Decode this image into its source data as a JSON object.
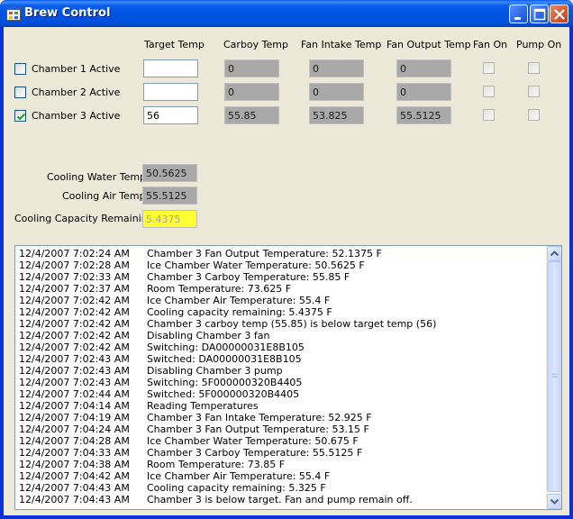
{
  "window": {
    "title": "Brew Control",
    "icons": {
      "app": "app-form-icon",
      "minimize": "minimize-icon",
      "maximize": "maximize-icon",
      "close": "close-icon"
    }
  },
  "headers": {
    "target_temp": "Target Temp",
    "carboy_temp": "Carboy Temp",
    "fan_intake_temp": "Fan Intake Temp",
    "fan_output_temp": "Fan Output Temp",
    "fan_on": "Fan On",
    "pump_on": "Pump On"
  },
  "chambers": [
    {
      "label": "Chamber 1 Active",
      "active": false,
      "target_temp": "",
      "carboy_temp": "0",
      "fan_intake_temp": "0",
      "fan_output_temp": "0",
      "fan_on": false,
      "pump_on": false
    },
    {
      "label": "Chamber 2 Active",
      "active": false,
      "target_temp": "",
      "carboy_temp": "0",
      "fan_intake_temp": "0",
      "fan_output_temp": "0",
      "fan_on": false,
      "pump_on": false
    },
    {
      "label": "Chamber 3 Active",
      "active": true,
      "target_temp": "56",
      "carboy_temp": "55.85",
      "fan_intake_temp": "53.825",
      "fan_output_temp": "55.5125",
      "fan_on": false,
      "pump_on": false
    }
  ],
  "cooling": {
    "water_temp_label": "Cooling Water Temp",
    "water_temp": "50.5625",
    "air_temp_label": "Cooling Air Temp",
    "air_temp": "55.5125",
    "capacity_label": "Cooling Capacity Remaining",
    "capacity": "5.4375"
  },
  "log": [
    {
      "time": "12/4/2007 7:02:24 AM",
      "message": "Chamber 3 Fan Output Temperature: 52.1375 F"
    },
    {
      "time": "12/4/2007 7:02:28 AM",
      "message": "Ice Chamber Water Temperature: 50.5625 F"
    },
    {
      "time": "12/4/2007 7:02:33 AM",
      "message": "Chamber 3 Carboy Temperature: 55.85 F"
    },
    {
      "time": "12/4/2007 7:02:37 AM",
      "message": "Room Temperature: 73.625 F"
    },
    {
      "time": "12/4/2007 7:02:42 AM",
      "message": "Ice Chamber Air Temperature: 55.4 F"
    },
    {
      "time": "12/4/2007 7:02:42 AM",
      "message": "Cooling capacity remaining:  5.4375 F"
    },
    {
      "time": "12/4/2007 7:02:42 AM",
      "message": "Chamber 3 carboy temp (55.85) is below target temp (56)"
    },
    {
      "time": "12/4/2007 7:02:42 AM",
      "message": "Disabling Chamber 3 fan"
    },
    {
      "time": "12/4/2007 7:02:42 AM",
      "message": "Switching: DA00000031E8B105"
    },
    {
      "time": "12/4/2007 7:02:43 AM",
      "message": "Switched: DA00000031E8B105"
    },
    {
      "time": "12/4/2007 7:02:43 AM",
      "message": "Disabling Chamber 3 pump"
    },
    {
      "time": "12/4/2007 7:02:43 AM",
      "message": "Switching: 5F000000320B4405"
    },
    {
      "time": "12/4/2007 7:02:44 AM",
      "message": "Switched: 5F000000320B4405"
    },
    {
      "time": "12/4/2007 7:04:14 AM",
      "message": "Reading Temperatures"
    },
    {
      "time": "12/4/2007 7:04:19 AM",
      "message": "Chamber 3 Fan Intake Temperature: 52.925 F"
    },
    {
      "time": "12/4/2007 7:04:24 AM",
      "message": "Chamber 3 Fan Output Temperature: 53.15 F"
    },
    {
      "time": "12/4/2007 7:04:28 AM",
      "message": "Ice Chamber Water Temperature: 50.675 F"
    },
    {
      "time": "12/4/2007 7:04:33 AM",
      "message": "Chamber 3 Carboy Temperature: 55.5125 F"
    },
    {
      "time": "12/4/2007 7:04:38 AM",
      "message": "Room Temperature: 73.85 F"
    },
    {
      "time": "12/4/2007 7:04:42 AM",
      "message": "Ice Chamber Air Temperature: 55.4 F"
    },
    {
      "time": "12/4/2007 7:04:43 AM",
      "message": "Cooling capacity remaining:  5.325 F"
    },
    {
      "time": "12/4/2007 7:04:43 AM",
      "message": "Chamber 3 is below target.  Fan and pump remain off."
    }
  ],
  "colors": {
    "title_bar": "#0054E3",
    "form_background": "#ECE9D8",
    "readonly_field": "#A9A9A9",
    "capacity_warning": "#FFFF33"
  }
}
